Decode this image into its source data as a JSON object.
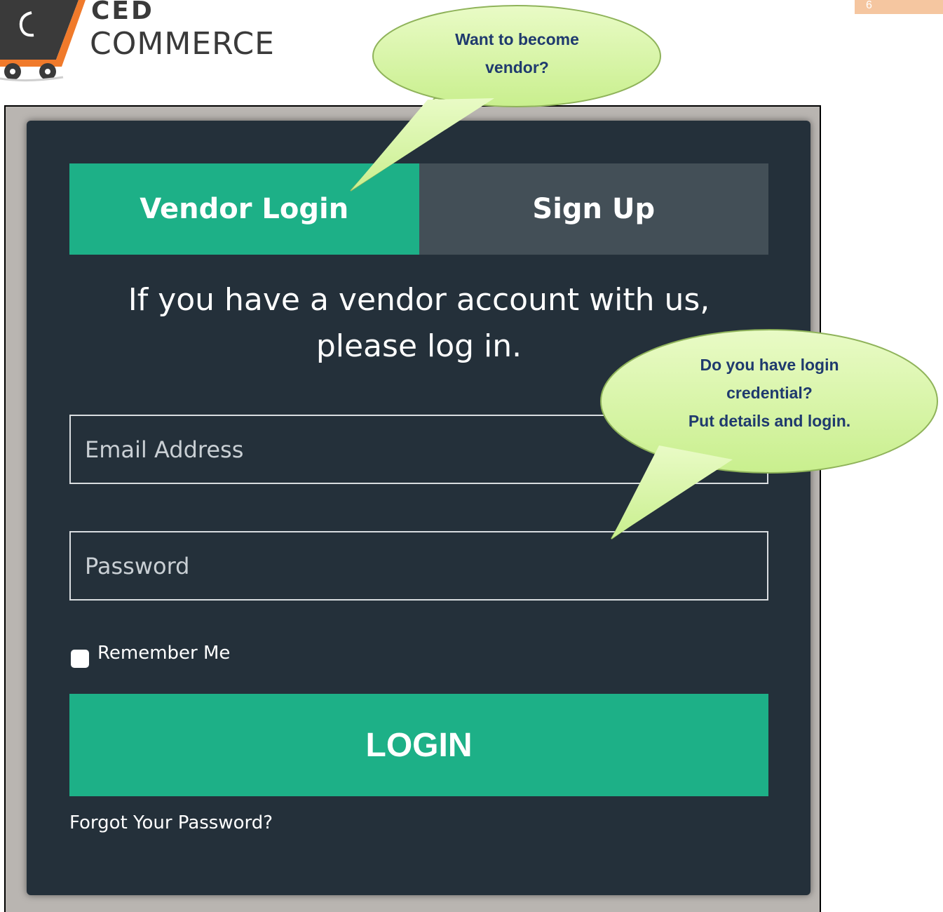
{
  "header": {
    "logo_top": "CED",
    "logo_bottom": "COMMERCE",
    "page_number": "6"
  },
  "login_panel": {
    "tabs": [
      {
        "label": "Vendor Login",
        "active": true
      },
      {
        "label": "Sign Up",
        "active": false
      }
    ],
    "intro_line1": "If you have a vendor account with us,",
    "intro_line2": "please log in.",
    "email_placeholder": "Email Address",
    "password_placeholder": "Password",
    "remember_label": "Remember Me",
    "remember_checked": false,
    "login_label": "LOGIN",
    "forgot_label": "Forgot Your Password?"
  },
  "callouts": {
    "become_vendor": {
      "line1": "Want to become",
      "line2": "vendor?"
    },
    "login_help": {
      "line1": "Do you have login",
      "line2": "credential?",
      "line3": "Put details and login."
    }
  },
  "colors": {
    "panel_bg": "#24303a",
    "accent_green": "#1db087",
    "tab_inactive": "#434f57",
    "callout_fill": "#d8f5a6",
    "callout_text": "#1f3a6e",
    "page_number_bg": "#f5c6a0"
  }
}
